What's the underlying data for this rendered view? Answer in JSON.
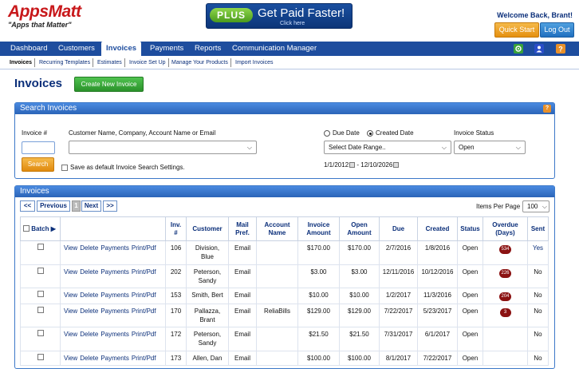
{
  "brand": {
    "name": "AppsMatt",
    "tagline": "\"Apps that Matter\""
  },
  "banner": {
    "badge": "PLUS",
    "headline": "Get Paid Faster!",
    "sub": "Click here"
  },
  "header": {
    "welcome": "Welcome Back, Brant!",
    "quick_start": "Quick Start",
    "log_out": "Log Out"
  },
  "nav": {
    "items": [
      "Dashboard",
      "Customers",
      "Invoices",
      "Payments",
      "Reports",
      "Communication Manager"
    ],
    "active": "Invoices"
  },
  "subnav": {
    "items": [
      "Invoices",
      "Recurring Templates",
      "Estimates",
      "Invoice Set Up",
      "Manage Your Products",
      "Import Invoices"
    ]
  },
  "page": {
    "title": "Invoices",
    "create_button": "Create New Invoice"
  },
  "search": {
    "title": "Search Invoices",
    "invoice_label": "Invoice #",
    "customer_label": "Customer Name, Company, Account Name or Email",
    "due_date_label": "Due Date",
    "created_date_label": "Created Date",
    "date_range_value": "Select Date Range..",
    "date_from": "1/1/2012",
    "date_to": "12/10/2026",
    "date_sep": " - ",
    "status_label": "Invoice Status",
    "status_value": "Open",
    "search_button": "Search",
    "save_default_label": "Save as default Invoice Search Settings."
  },
  "invoices": {
    "title": "Invoices",
    "pager": {
      "first": "<<",
      "prev": "Previous",
      "current": "1",
      "next": "Next",
      "last": ">>"
    },
    "items_per_page_label": "Items Per Page",
    "items_per_page_value": "100",
    "columns": {
      "batch": "Batch",
      "inv_line1": "Inv.",
      "inv_line2": "#",
      "customer": "Customer",
      "mail_line1": "Mail",
      "mail_line2": "Pref.",
      "account_line1": "Account",
      "account_line2": "Name",
      "amount_line1": "Invoice",
      "amount_line2": "Amount",
      "open_line1": "Open",
      "open_line2": "Amount",
      "due": "Due",
      "created": "Created",
      "status": "Status",
      "overdue_line1": "Overdue",
      "overdue_line2": "(Days)",
      "sent": "Sent"
    },
    "actions": {
      "view": "View",
      "delete": "Delete",
      "payments": "Payments",
      "print": "Print/Pdf"
    },
    "rows": [
      {
        "inv": "106",
        "customer_line1": "Division,",
        "customer_line2": "Blue",
        "mail": "Email",
        "account": "",
        "amount": "$170.00",
        "open": "$170.00",
        "due": "2/7/2016",
        "created": "1/8/2016",
        "status": "Open",
        "overdue": "534",
        "sent": "Yes"
      },
      {
        "inv": "202",
        "customer_line1": "Peterson,",
        "customer_line2": "Sandy",
        "mail": "Email",
        "account": "",
        "amount": "$3.00",
        "open": "$3.00",
        "due": "12/11/2016",
        "created": "10/12/2016",
        "status": "Open",
        "overdue": "226",
        "sent": "No"
      },
      {
        "inv": "153",
        "customer_line1": "Smith, Bert",
        "customer_line2": "",
        "mail": "Email",
        "account": "",
        "amount": "$10.00",
        "open": "$10.00",
        "due": "1/2/2017",
        "created": "11/3/2016",
        "status": "Open",
        "overdue": "204",
        "sent": "No"
      },
      {
        "inv": "170",
        "customer_line1": "Pallazza,",
        "customer_line2": "Brant",
        "mail": "Email",
        "account": "ReliaBills",
        "amount": "$129.00",
        "open": "$129.00",
        "due": "7/22/2017",
        "created": "5/23/2017",
        "status": "Open",
        "overdue": "3",
        "sent": "No"
      },
      {
        "inv": "172",
        "customer_line1": "Peterson,",
        "customer_line2": "Sandy",
        "mail": "Email",
        "account": "",
        "amount": "$21.50",
        "open": "$21.50",
        "due": "7/31/2017",
        "created": "6/1/2017",
        "status": "Open",
        "overdue": "",
        "sent": "No"
      },
      {
        "inv": "173",
        "customer_line1": "Allen, Dan",
        "customer_line2": "",
        "mail": "Email",
        "account": "",
        "amount": "$100.00",
        "open": "$100.00",
        "due": "8/1/2017",
        "created": "7/22/2017",
        "status": "Open",
        "overdue": "",
        "sent": "No"
      }
    ]
  },
  "colors": {
    "brand_red": "#c8181b",
    "nav_blue": "#1e4d9e",
    "panel_blue": "#3c78c8",
    "green": "#2b922b",
    "orange": "#e59010",
    "badge_red": "#8b1212"
  }
}
